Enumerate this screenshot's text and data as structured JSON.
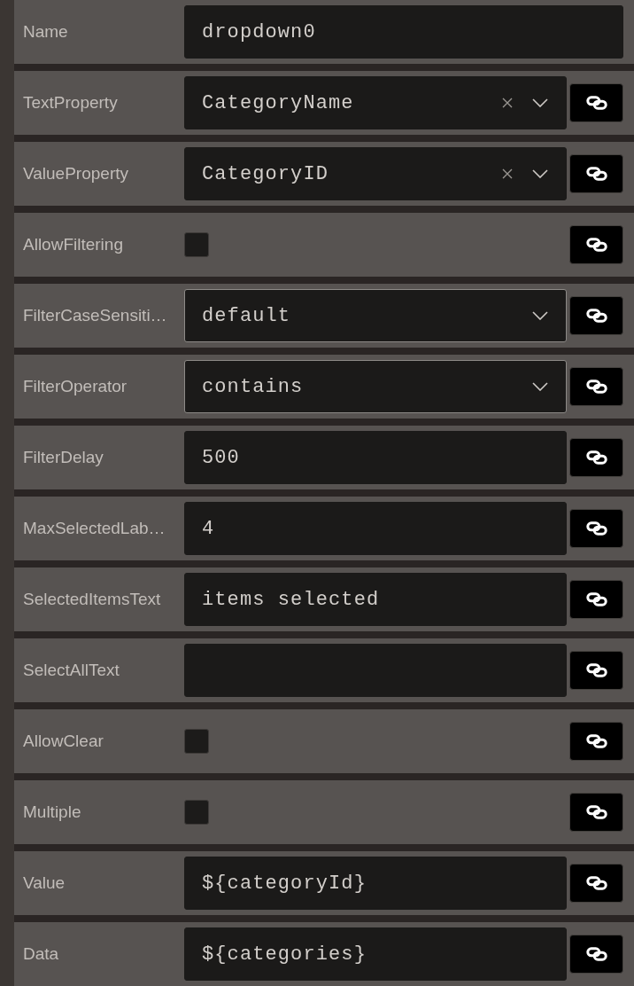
{
  "properties": [
    {
      "label": "Name",
      "kind": "text",
      "value": "dropdown0",
      "link_button": false
    },
    {
      "label": "TextProperty",
      "kind": "dropdown",
      "value": "CategoryName",
      "link_button": true
    },
    {
      "label": "ValueProperty",
      "kind": "dropdown",
      "value": "CategoryID",
      "link_button": true
    },
    {
      "label": "AllowFiltering",
      "kind": "checkbox",
      "checked": false,
      "link_button": true
    },
    {
      "label": "FilterCaseSensiti…",
      "kind": "select",
      "value": "default",
      "link_button": true
    },
    {
      "label": "FilterOperator",
      "kind": "select",
      "value": "contains",
      "link_button": true
    },
    {
      "label": "FilterDelay",
      "kind": "text",
      "value": "500",
      "link_button": true
    },
    {
      "label": "MaxSelectedLab…",
      "kind": "text",
      "value": "4",
      "link_button": true
    },
    {
      "label": "SelectedItemsText",
      "kind": "text",
      "value": "items selected",
      "link_button": true
    },
    {
      "label": "SelectAllText",
      "kind": "text",
      "link_button": true
    },
    {
      "label": "AllowClear",
      "kind": "checkbox",
      "checked": false,
      "link_button": true
    },
    {
      "label": "Multiple",
      "kind": "checkbox",
      "checked": false,
      "link_button": true
    },
    {
      "label": "Value",
      "kind": "text",
      "value": "${categoryId}",
      "link_button": true
    },
    {
      "label": "Data",
      "kind": "text",
      "value": "${categories}",
      "link_button": true
    }
  ]
}
